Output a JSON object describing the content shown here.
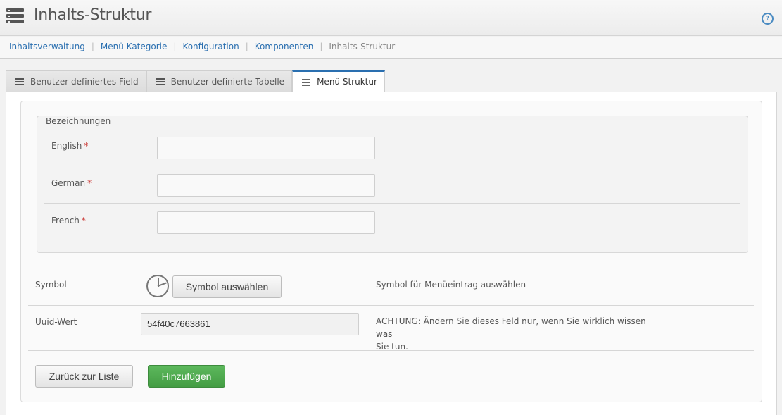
{
  "header": {
    "title": "Inhalts-Struktur",
    "help_icon": "?"
  },
  "breadcrumb": {
    "items": [
      "Inhaltsverwaltung",
      "Menü Kategorie",
      "Konfiguration",
      "Komponenten"
    ],
    "current": "Inhalts-Struktur",
    "separator": "|"
  },
  "tabs": [
    {
      "label": "Benutzer definiertes Field",
      "icon": "list-icon",
      "active": false
    },
    {
      "label": "Benutzer definierte Tabelle",
      "icon": "list-icon",
      "active": false
    },
    {
      "label": "Menü Struktur",
      "icon": "menu-icon",
      "active": true
    }
  ],
  "form": {
    "legend": "Bezeichnungen",
    "required_mark": "*",
    "fields": [
      {
        "label": "English",
        "value": ""
      },
      {
        "label": "German",
        "value": ""
      },
      {
        "label": "French",
        "value": ""
      }
    ],
    "symbol": {
      "label": "Symbol",
      "icon": "clock-icon",
      "button_label": "Symbol auswählen",
      "help": "Symbol für Menüeintrag auswählen"
    },
    "uuid": {
      "label": "Uuid-Wert",
      "value": "54f40c7663861",
      "help_line1": "ACHTUNG: Ändern Sie dieses Feld nur, wenn Sie wirklich wissen was",
      "help_line2": "Sie tun."
    },
    "buttons": {
      "back": "Zurück zur Liste",
      "add": "Hinzufügen"
    }
  },
  "colors": {
    "link": "#2a6fb0",
    "primary_button": "#5cb85c",
    "required": "#c9302c"
  }
}
